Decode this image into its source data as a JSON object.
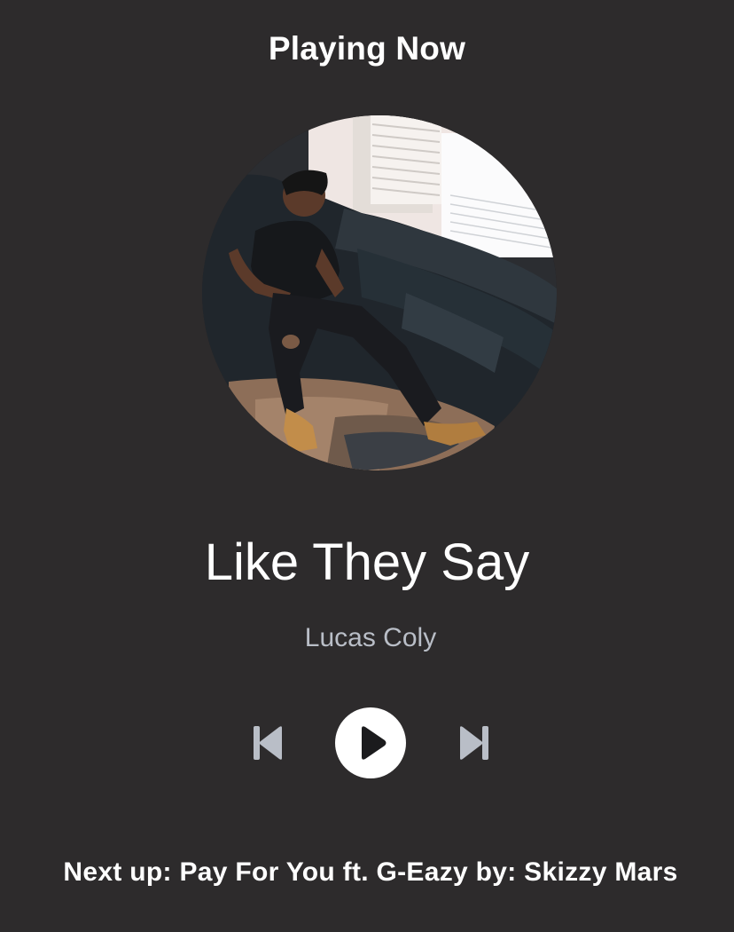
{
  "header": {
    "title": "Playing Now"
  },
  "track": {
    "title": "Like They Say",
    "artist": "Lucas Coly"
  },
  "controls": {
    "previous_icon": "skip-previous-icon",
    "play_icon": "play-icon",
    "next_icon": "skip-next-icon"
  },
  "queue": {
    "next_up": "Next up: Pay For You ft. G-Eazy by: Skizzy Mars"
  },
  "colors": {
    "background": "#2d2b2c",
    "text_primary": "#ffffff",
    "text_secondary": "#b9bec7",
    "control_gray": "#b9bec7"
  }
}
